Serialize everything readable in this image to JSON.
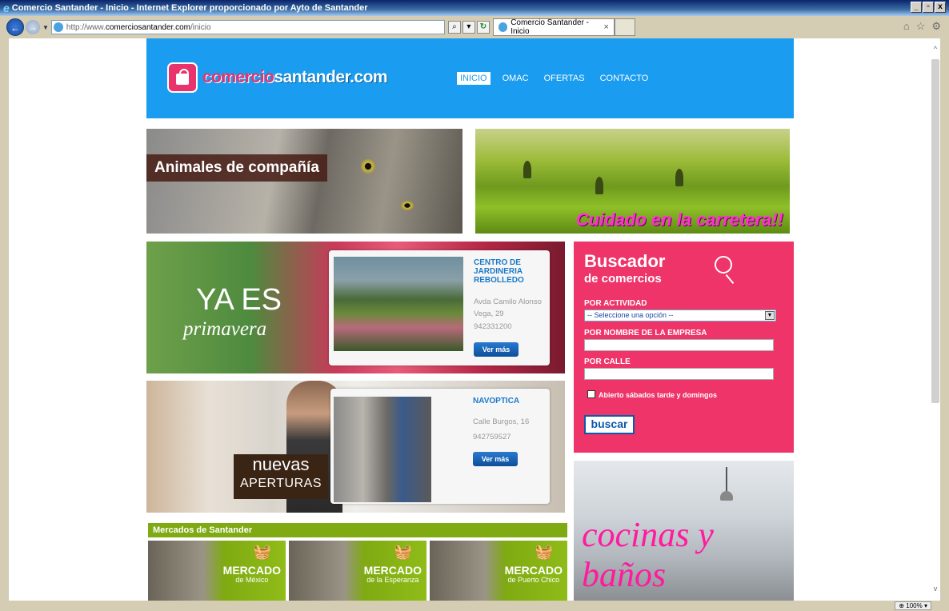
{
  "window": {
    "title": "Comercio Santander - Inicio - Internet Explorer proporcionado por Ayto de Santander",
    "minimize": "_",
    "maximize": "\u0001",
    "close": "x"
  },
  "browser": {
    "url_prefix": "http://www.",
    "url_domain": "comerciosantander.com",
    "url_path": "/inicio",
    "tab_title": "Comercio Santander - Inicio",
    "tab_close": "×",
    "zoom": "100%"
  },
  "header": {
    "logo_part1": "comercio",
    "logo_part2": "santander.com",
    "menu": [
      "INICIO",
      "OMAC",
      "OFERTAS",
      "CONTACTO"
    ]
  },
  "banners": {
    "cat": "Animales de compañía",
    "field": "Cuidado en la carretera!!",
    "spring_line1": "YA ES",
    "spring_line2": "primavera",
    "aperturas_line1": "nuevas",
    "aperturas_line2": "APERTURAS",
    "kitchen_line1": "cocinas y",
    "kitchen_line2": "baños"
  },
  "cards": [
    {
      "title": "CENTRO DE JARDINERIA REBOLLEDO",
      "address": "Avda Camilo Alonso Vega, 29",
      "phone": "942331200",
      "button": "Ver más"
    },
    {
      "title": "NAVOPTICA",
      "address": "Calle Burgos, 16",
      "phone": "942759527",
      "button": "Ver más"
    }
  ],
  "search": {
    "title1": "Buscador",
    "title2": "de comercios",
    "actividad_label": "POR ACTIVIDAD",
    "actividad_value": "-- Seleccione una opción --",
    "nombre_label": "POR NOMBRE DE LA EMPRESA",
    "calle_label": "POR CALLE",
    "checkbox_label": "Abierto sábados tarde y domingos",
    "button": "buscar"
  },
  "mercados": {
    "heading": "Mercados de Santander",
    "items": [
      {
        "title": "MERCADO",
        "subtitle": "de México"
      },
      {
        "title": "MERCADO",
        "subtitle": "de la Esperanza"
      },
      {
        "title": "MERCADO",
        "subtitle": "de Puerto Chico"
      }
    ]
  },
  "colors": {
    "header_blue": "#1a9cf0",
    "brand_pink": "#ee3468",
    "link_blue": "#1a7ac8",
    "mercados_green": "#7faa12"
  }
}
